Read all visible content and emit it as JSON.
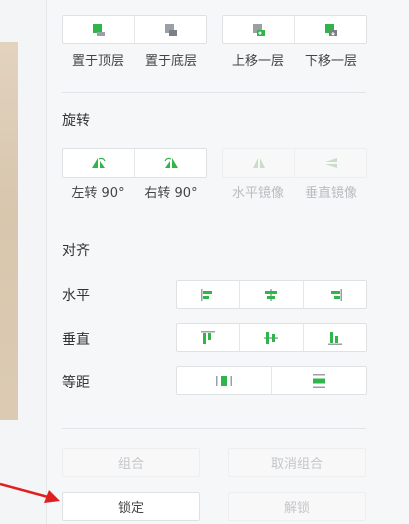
{
  "layer_order": {
    "bring_to_front": "置于顶层",
    "send_to_back": "置于底层",
    "move_up": "上移一层",
    "move_down": "下移一层"
  },
  "rotate": {
    "title": "旋转",
    "left": "左转 90°",
    "right": "右转 90°",
    "flip_h": "水平镜像",
    "flip_v": "垂直镜像"
  },
  "align": {
    "title": "对齐",
    "horizontal": "水平",
    "vertical": "垂直",
    "distribute": "等距"
  },
  "actions": {
    "group": "组合",
    "ungroup": "取消组合",
    "lock": "锁定",
    "unlock": "解锁"
  },
  "colors": {
    "accent": "#2fb54a",
    "disabled_text": "#c3c6ca",
    "pointer_arrow": "#e02020"
  }
}
